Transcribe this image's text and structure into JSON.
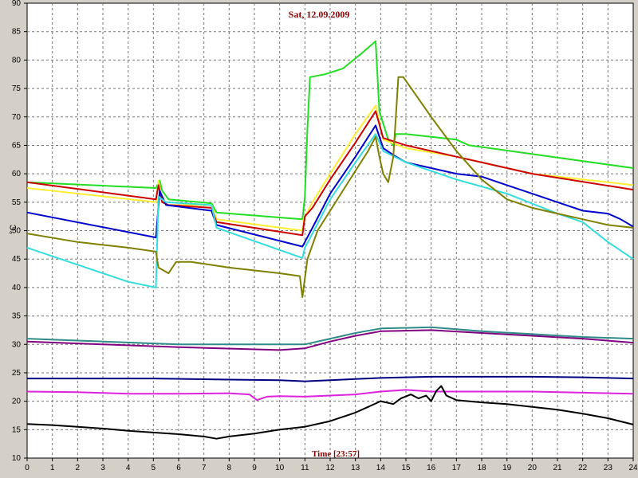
{
  "chart_data": {
    "type": "line",
    "title": "Sat, 12.09.2009",
    "xlabel": "Time [23:57]",
    "ylabel": "°C",
    "xlim": [
      0,
      24
    ],
    "ylim": [
      10,
      90
    ],
    "xticks": [
      0,
      1,
      2,
      3,
      4,
      5,
      6,
      7,
      8,
      9,
      10,
      11,
      12,
      13,
      14,
      15,
      16,
      17,
      18,
      19,
      20,
      21,
      22,
      23,
      24
    ],
    "yticks": [
      10,
      15,
      20,
      25,
      30,
      35,
      40,
      45,
      50,
      55,
      60,
      65,
      70,
      75,
      80,
      85,
      90
    ],
    "grid": true,
    "background": "#ffffff",
    "series": [
      {
        "color": "#22dd22",
        "points": [
          [
            0,
            58.5
          ],
          [
            5.1,
            57.5
          ],
          [
            5.25,
            58.8
          ],
          [
            5.35,
            57
          ],
          [
            5.6,
            55.5
          ],
          [
            7.3,
            54.8
          ],
          [
            7.5,
            53.2
          ],
          [
            10.9,
            52
          ],
          [
            11.0,
            56
          ],
          [
            11.1,
            68
          ],
          [
            11.2,
            77
          ],
          [
            11.8,
            77.5
          ],
          [
            12.5,
            78.5
          ],
          [
            13.2,
            81
          ],
          [
            13.8,
            83.3
          ],
          [
            13.95,
            71
          ],
          [
            14.3,
            66
          ],
          [
            14.5,
            65
          ],
          [
            14.6,
            67
          ],
          [
            15,
            67
          ],
          [
            17,
            66
          ],
          [
            17.5,
            65
          ],
          [
            24,
            61
          ]
        ]
      },
      {
        "color": "#ffee33",
        "points": [
          [
            0,
            57.5
          ],
          [
            5.1,
            55
          ],
          [
            5.2,
            58.8
          ],
          [
            5.35,
            55
          ],
          [
            5.6,
            54.5
          ],
          [
            7.3,
            54.5
          ],
          [
            7.5,
            52
          ],
          [
            10.9,
            50
          ],
          [
            10.95,
            52
          ],
          [
            11.3,
            55
          ],
          [
            12,
            60
          ],
          [
            13,
            67
          ],
          [
            13.8,
            72
          ],
          [
            14.1,
            66
          ],
          [
            15,
            64.5
          ],
          [
            17,
            63
          ],
          [
            20,
            60
          ],
          [
            24,
            58
          ]
        ]
      },
      {
        "color": "#cc0000",
        "points": [
          [
            0,
            58.5
          ],
          [
            5.1,
            55.5
          ],
          [
            5.2,
            58
          ],
          [
            5.35,
            55
          ],
          [
            5.6,
            54.5
          ],
          [
            7.3,
            54
          ],
          [
            7.5,
            51.5
          ],
          [
            10.9,
            49.2
          ],
          [
            11,
            52.5
          ],
          [
            11.3,
            54
          ],
          [
            12,
            59
          ],
          [
            13,
            65.5
          ],
          [
            13.8,
            71
          ],
          [
            14.1,
            66.3
          ],
          [
            15,
            65
          ],
          [
            17,
            63
          ],
          [
            20,
            60
          ],
          [
            24,
            57.2
          ]
        ]
      },
      {
        "color": "#0000cc",
        "points": [
          [
            0,
            53.2
          ],
          [
            5.1,
            48.8
          ],
          [
            5.25,
            57
          ],
          [
            5.5,
            54.5
          ],
          [
            7.3,
            53.5
          ],
          [
            7.5,
            51
          ],
          [
            10.9,
            47.2
          ],
          [
            11,
            48
          ],
          [
            11.3,
            50.5
          ],
          [
            12,
            56.5
          ],
          [
            13,
            63
          ],
          [
            13.8,
            68.5
          ],
          [
            14.1,
            64.5
          ],
          [
            14.5,
            63.3
          ],
          [
            15,
            62
          ],
          [
            16,
            61
          ],
          [
            17,
            60
          ],
          [
            18,
            59.5
          ],
          [
            19,
            58
          ],
          [
            20,
            56.5
          ],
          [
            21,
            55
          ],
          [
            22,
            53.5
          ],
          [
            23,
            53
          ],
          [
            23.5,
            52
          ],
          [
            24,
            50.7
          ]
        ]
      },
      {
        "color": "#33dddd",
        "points": [
          [
            0,
            47
          ],
          [
            2,
            44
          ],
          [
            4,
            41
          ],
          [
            5.1,
            40
          ],
          [
            5.2,
            56
          ],
          [
            5.5,
            55
          ],
          [
            7.3,
            54.5
          ],
          [
            7.5,
            50.5
          ],
          [
            10.9,
            45.2
          ],
          [
            11,
            47
          ],
          [
            11.3,
            49.5
          ],
          [
            12,
            55.5
          ],
          [
            13,
            62
          ],
          [
            13.8,
            67
          ],
          [
            14.1,
            64
          ],
          [
            15,
            62
          ],
          [
            17,
            59
          ],
          [
            19,
            56.5
          ],
          [
            21,
            53
          ],
          [
            22,
            51.5
          ],
          [
            23,
            48
          ],
          [
            24,
            45
          ]
        ]
      },
      {
        "color": "#808000",
        "points": [
          [
            0,
            49.5
          ],
          [
            2,
            48
          ],
          [
            4,
            47
          ],
          [
            5.1,
            46.3
          ],
          [
            5.2,
            43.5
          ],
          [
            5.6,
            42.5
          ],
          [
            5.9,
            44.5
          ],
          [
            6.5,
            44.5
          ],
          [
            8,
            43.5
          ],
          [
            10,
            42.5
          ],
          [
            10.8,
            42
          ],
          [
            10.9,
            38.3
          ],
          [
            11.1,
            45
          ],
          [
            11.5,
            50
          ],
          [
            12.5,
            57
          ],
          [
            13.5,
            64
          ],
          [
            13.8,
            66.5
          ],
          [
            13.95,
            63
          ],
          [
            14.1,
            60
          ],
          [
            14.3,
            58.5
          ],
          [
            14.5,
            63
          ],
          [
            14.7,
            77
          ],
          [
            14.9,
            77
          ],
          [
            16,
            70
          ],
          [
            17,
            64
          ],
          [
            18,
            59
          ],
          [
            19,
            55.5
          ],
          [
            20,
            54
          ],
          [
            21,
            53
          ],
          [
            22,
            52
          ],
          [
            23,
            51
          ],
          [
            24,
            50.5
          ]
        ]
      },
      {
        "color": "#2e8b87",
        "points": [
          [
            0,
            31
          ],
          [
            3,
            30.5
          ],
          [
            6,
            30
          ],
          [
            10,
            30
          ],
          [
            11,
            30
          ],
          [
            12,
            31
          ],
          [
            13,
            32
          ],
          [
            14,
            32.8
          ],
          [
            16,
            33
          ],
          [
            18,
            32.3
          ],
          [
            20,
            31.8
          ],
          [
            22,
            31.3
          ],
          [
            24,
            31
          ]
        ]
      },
      {
        "color": "#800080",
        "points": [
          [
            0,
            30.5
          ],
          [
            3,
            30
          ],
          [
            6,
            29.5
          ],
          [
            10,
            29
          ],
          [
            11,
            29.3
          ],
          [
            12,
            30.5
          ],
          [
            13,
            31.5
          ],
          [
            14,
            32.3
          ],
          [
            16,
            32.5
          ],
          [
            18,
            32
          ],
          [
            20,
            31.5
          ],
          [
            22,
            31
          ],
          [
            24,
            30.3
          ]
        ]
      },
      {
        "color": "#000080",
        "points": [
          [
            0,
            24
          ],
          [
            5,
            24
          ],
          [
            8,
            23.8
          ],
          [
            10,
            23.7
          ],
          [
            11,
            23.5
          ],
          [
            12,
            23.7
          ],
          [
            13,
            23.9
          ],
          [
            14,
            24.1
          ],
          [
            16,
            24.3
          ],
          [
            18,
            24.3
          ],
          [
            20,
            24.3
          ],
          [
            22,
            24.2
          ],
          [
            24,
            24
          ]
        ]
      },
      {
        "color": "#dd22dd",
        "points": [
          [
            0,
            21.7
          ],
          [
            2,
            21.6
          ],
          [
            4,
            21.3
          ],
          [
            6,
            21.3
          ],
          [
            8,
            21.4
          ],
          [
            8.8,
            21.2
          ],
          [
            9.1,
            20.2
          ],
          [
            9.5,
            20.8
          ],
          [
            10,
            20.9
          ],
          [
            11,
            20.8
          ],
          [
            12,
            21
          ],
          [
            13,
            21.2
          ],
          [
            14,
            21.7
          ],
          [
            15,
            22
          ],
          [
            16,
            21.7
          ],
          [
            18,
            21.7
          ],
          [
            20,
            21.7
          ],
          [
            22,
            21.5
          ],
          [
            24,
            21.3
          ]
        ]
      },
      {
        "color": "#000000",
        "points": [
          [
            0,
            16
          ],
          [
            1,
            15.8
          ],
          [
            2,
            15.5
          ],
          [
            3,
            15.2
          ],
          [
            4,
            14.8
          ],
          [
            5,
            14.5
          ],
          [
            6,
            14.2
          ],
          [
            7,
            13.8
          ],
          [
            7.5,
            13.4
          ],
          [
            8,
            13.8
          ],
          [
            9,
            14.3
          ],
          [
            10,
            15
          ],
          [
            11,
            15.5
          ],
          [
            12,
            16.5
          ],
          [
            13,
            18
          ],
          [
            13.5,
            19
          ],
          [
            14,
            20
          ],
          [
            14.5,
            19.5
          ],
          [
            14.8,
            20.5
          ],
          [
            15.2,
            21.2
          ],
          [
            15.5,
            20.5
          ],
          [
            15.8,
            21
          ],
          [
            16,
            20
          ],
          [
            16.2,
            21.8
          ],
          [
            16.4,
            22.7
          ],
          [
            16.6,
            21
          ],
          [
            17,
            20.2
          ],
          [
            18,
            19.8
          ],
          [
            19,
            19.5
          ],
          [
            20,
            19
          ],
          [
            21,
            18.5
          ],
          [
            22,
            17.8
          ],
          [
            23,
            17
          ],
          [
            24,
            15.9
          ]
        ]
      }
    ]
  }
}
